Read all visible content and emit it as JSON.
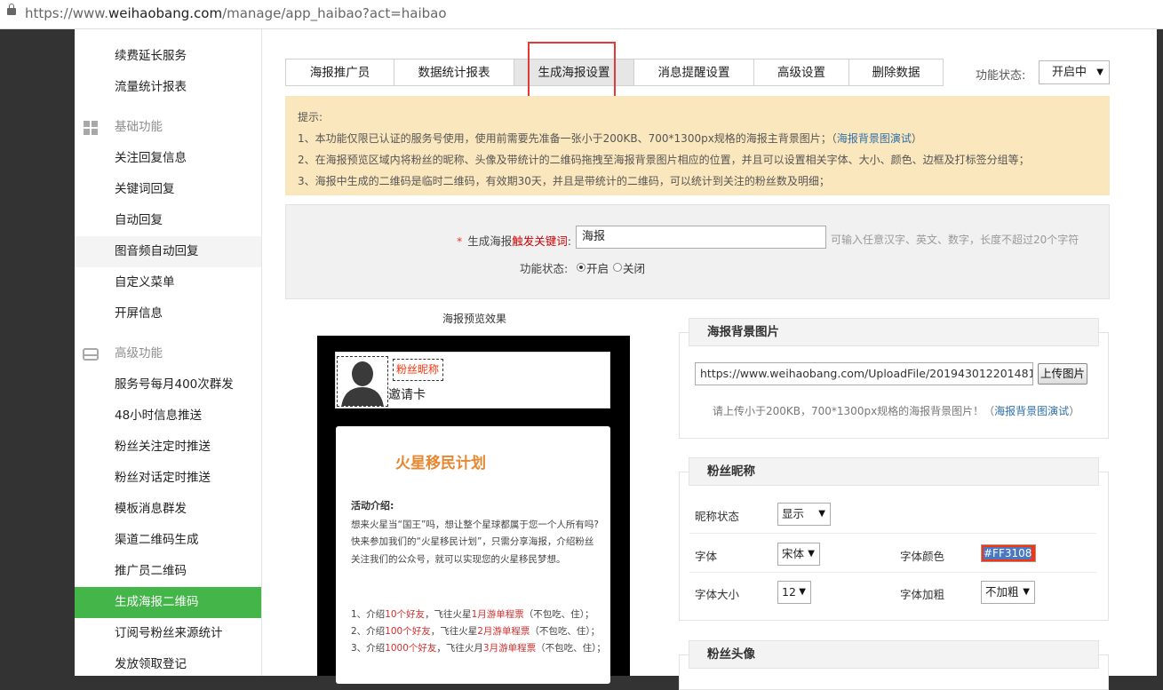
{
  "browser": {
    "url_prefix": "https://www.",
    "url_host": "weihaobang.com",
    "url_path": "/manage/app_haibao?act=haibao"
  },
  "sidebar": {
    "items_top": [
      "续费延长服务",
      "流量统计报表"
    ],
    "group_basic": "基础功能",
    "basic_items": [
      "关注回复信息",
      "关键词回复",
      "自动回复",
      "图音频自动回复",
      "自定义菜单",
      "开屏信息"
    ],
    "group_advanced": "高级功能",
    "advanced_items": [
      "服务号每月400次群发",
      "48小时信息推送",
      "粉丝关注定时推送",
      "粉丝对话定时推送",
      "模板消息群发",
      "渠道二维码生成",
      "推广员二维码",
      "生成海报二维码",
      "订阅号粉丝来源统计",
      "发放领取登记"
    ]
  },
  "tabs": [
    "海报推广员",
    "数据统计报表",
    "生成海报设置",
    "消息提醒设置",
    "高级设置",
    "删除数据"
  ],
  "function_status": {
    "label": "功能状态:",
    "value": "开启中"
  },
  "tips": {
    "title": "提示:",
    "line1": "1、本功能仅限已认证的服务号使用，使用前需要先准备一张小于200KB、700*1300px规格的海报主背景图片；（",
    "line1_link": "海报背景图演试",
    "line1_end": "）",
    "line2": "2、在海报预览区域内将粉丝的昵称、头像及带统计的二维码拖拽至海报背景图片相应的位置，并且可以设置相关字体、大小、颜色、边框及打标签分组等；",
    "line3": "3、海报中生成的二维码是临时二维码，有效期30天，并且是带统计的二维码，可以统计到关注的粉丝数及明细；"
  },
  "form": {
    "kw_star": "*",
    "kw_label_a": "生成海报",
    "kw_label_b": "触发关键词",
    "kw_label_c": ":",
    "kw_value": "海报",
    "kw_hint": "可输入任意汉字、英文、数字，长度不超过20个字符",
    "status_label": "功能状态:",
    "on": "开启",
    "off": "关闭"
  },
  "preview": {
    "title": "海报预览效果",
    "nickname": "粉丝昵称",
    "invite": "邀请卡",
    "poster_title": "火星移民计划",
    "intro_title": "活动介绍:",
    "intro1": "想来火星当“国王”吗，想让整个星球都属于您一个人所有吗?",
    "intro2": "快来参加我们的“火星移民计划”，只需分享海报，介绍粉丝",
    "intro3": "关注我们的公众号，就可以实现您的火星移民梦想。",
    "rule1": [
      "1、介绍",
      "10个好友",
      "，飞往火星",
      "1月游单程票",
      "（不包吃、住）；"
    ],
    "rule2": [
      "2、介绍",
      "100个好友",
      "，飞往火星",
      "2月游单程票",
      "（不包吃、住）；"
    ],
    "rule3": [
      "3、介绍",
      "1000个好友",
      "，飞往火月",
      "3月游单程票",
      "（不包吃、住）；"
    ]
  },
  "bg_panel": {
    "title": "海报背景图片",
    "url": "https://www.weihaobang.com/UploadFile/201943012201481026.jpg",
    "upload": "上传图片",
    "hint": "请上传小于200KB，700*1300px规格的海报背景图片！（",
    "hint_link": "海报背景图演试",
    "hint_end": "）"
  },
  "nick_panel": {
    "title": "粉丝昵称",
    "state_label": "昵称状态",
    "state_value": "显示",
    "font_label": "字体",
    "font_value": "宋体",
    "color_label": "字体颜色",
    "color_value": "#FF3108",
    "size_label": "字体大小",
    "size_value": "12",
    "bold_label": "字体加粗",
    "bold_value": "不加粗"
  },
  "avatar_panel": {
    "title": "粉丝头像"
  }
}
